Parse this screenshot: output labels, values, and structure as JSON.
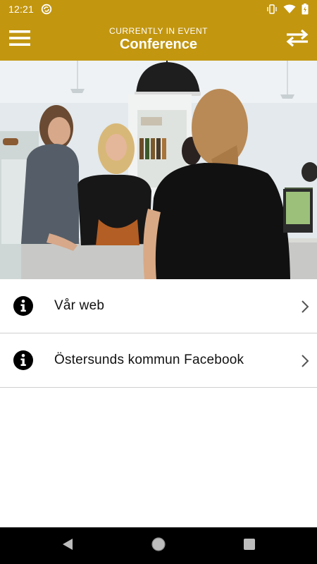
{
  "status_bar": {
    "time": "12:21",
    "icons": [
      "sync-circle-icon",
      "vibrate-icon",
      "wifi-icon",
      "battery-icon"
    ]
  },
  "app_bar": {
    "subtitle": "CURRENTLY IN EVENT",
    "title": "Conference",
    "menu_icon": "hamburger-menu-icon",
    "switch_icon": "swap-arrows-icon",
    "background_color": "#c2960f"
  },
  "hero": {
    "description": "photo"
  },
  "list": {
    "items": [
      {
        "label": "Vår web",
        "icon": "info-circle-icon",
        "trailing_icon": "chevron-right-icon"
      },
      {
        "label": "Östersunds kommun Facebook",
        "icon": "info-circle-icon",
        "trailing_icon": "chevron-right-icon"
      }
    ]
  },
  "nav_bar": {
    "buttons": [
      "back-icon",
      "home-icon",
      "recents-icon"
    ]
  }
}
